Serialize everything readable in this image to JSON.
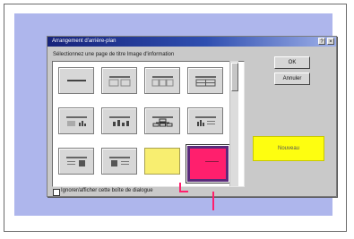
{
  "dialog": {
    "title": "Arrangement d'arrière-plan",
    "instruction": "Sélectionnez une page de titre Image d'information",
    "ok_label": "OK",
    "cancel_label": "Annuler",
    "close_glyph": "×",
    "help_glyph": "?",
    "checkbox_label": "Ignorer/afficher cette boîte de dialogue",
    "checkbox_checked": false
  },
  "gallery": {
    "tiles": [
      {
        "name": "layout-title-only",
        "icon": "single-line-icon"
      },
      {
        "name": "layout-two-columns",
        "icon": "two-column-icon"
      },
      {
        "name": "layout-three-columns",
        "icon": "three-column-icon"
      },
      {
        "name": "layout-four-cells",
        "icon": "grid-icon"
      },
      {
        "name": "layout-chart-left",
        "icon": "chart-icon"
      },
      {
        "name": "layout-bar-chart",
        "icon": "bar-chart-icon"
      },
      {
        "name": "layout-org-chart",
        "icon": "org-chart-icon"
      },
      {
        "name": "layout-chart-text",
        "icon": "chart-text-icon"
      },
      {
        "name": "layout-text-image",
        "icon": "text-image-icon"
      },
      {
        "name": "layout-image-text",
        "icon": "image-text-icon"
      },
      {
        "name": "layout-yellow",
        "icon": "yellow-swatch",
        "color": "#f8ee70"
      },
      {
        "name": "layout-magenta-selected",
        "icon": "magenta-swatch",
        "color": "#ff1f6d",
        "selected": true
      }
    ]
  },
  "preview": {
    "label": "Nouveau",
    "color": "#fefe10"
  },
  "colors": {
    "backdrop": "#aeb6ec",
    "accent": "#ff1f6d",
    "titlebar": "#17237a"
  }
}
